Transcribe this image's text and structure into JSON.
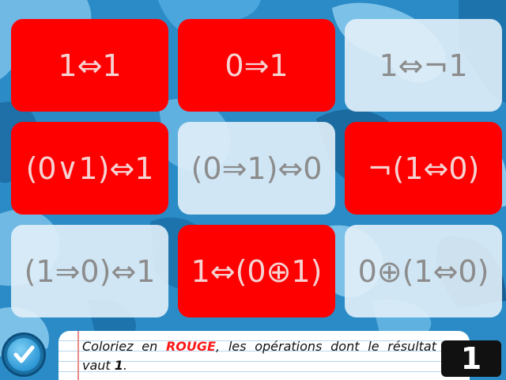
{
  "tiles": [
    {
      "label": "1⇔1",
      "state": "red"
    },
    {
      "label": "0⇒1",
      "state": "red"
    },
    {
      "label": "1⇔¬1",
      "state": "light"
    },
    {
      "label": "(0∨1)⇔1",
      "state": "red"
    },
    {
      "label": "(0⇒1)⇔0",
      "state": "light"
    },
    {
      "label": "¬(1⇔0)",
      "state": "red"
    },
    {
      "label": "(1⇒0)⇔1",
      "state": "light"
    },
    {
      "label": "1⇔(0⊕1)",
      "state": "red"
    },
    {
      "label": "0⊕(1⇔0)",
      "state": "light"
    }
  ],
  "instruction": {
    "part1": "Coloriez en ",
    "keyword": "ROUGE",
    "part2": ", les opérations dont le résultat vaut ",
    "value": "1",
    "part3": "."
  },
  "level_number": "1",
  "colors": {
    "background": "#2b8bc6",
    "tile_red": "#ff0000",
    "tile_light": "#e2eff8",
    "badge": "#111111"
  },
  "icons": {
    "validate": "check-icon"
  }
}
